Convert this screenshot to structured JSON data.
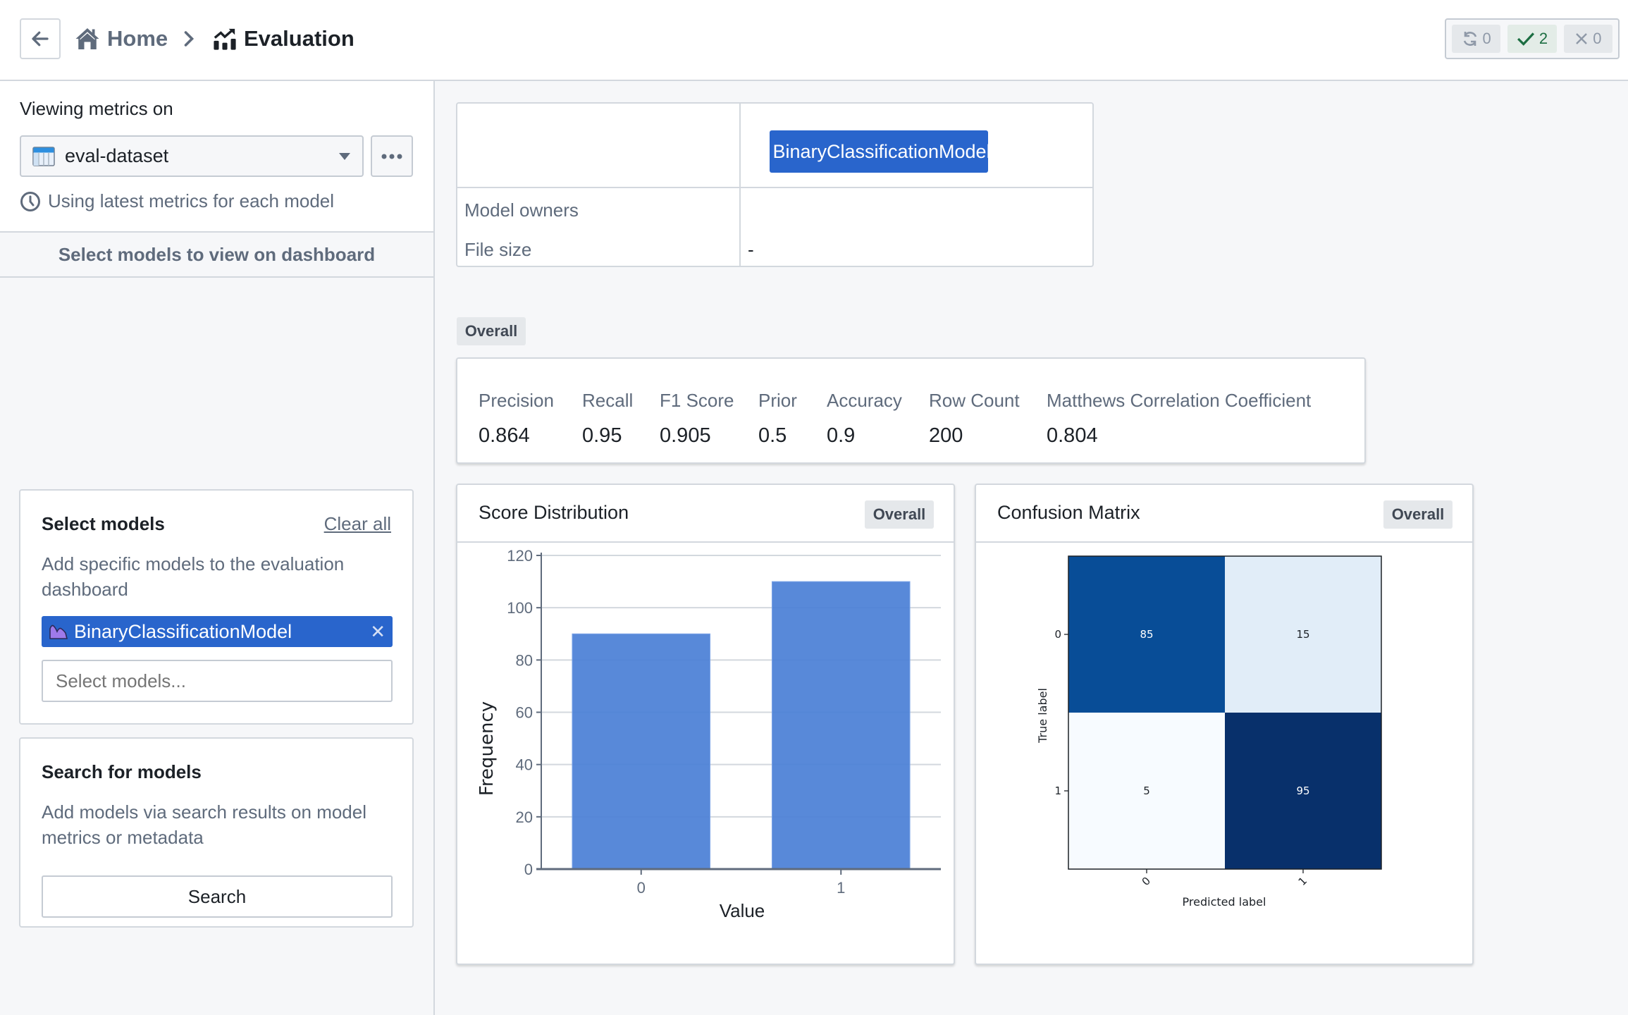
{
  "header": {
    "back_label": "Back",
    "breadcrumb": [
      {
        "label": "Home",
        "icon": "home-icon"
      },
      {
        "label": "Evaluation",
        "icon": "chart-growth-icon"
      }
    ],
    "status": [
      {
        "icon": "refresh-icon",
        "count": "0"
      },
      {
        "icon": "check-icon",
        "count": "2"
      },
      {
        "icon": "cross-icon",
        "count": "0"
      }
    ]
  },
  "sidebar": {
    "viewing_label": "Viewing metrics on",
    "dataset": {
      "icon": "dataset-table-icon",
      "value": "eval-dataset"
    },
    "latest_text": "Using latest metrics for each model",
    "section_title": "Select models to view on dashboard",
    "select_card": {
      "title": "Select models",
      "clear_all": "Clear all",
      "description": "Add specific models to the evaluation dashboard",
      "selected": [
        {
          "name": "BinaryClassificationModel"
        }
      ],
      "input_placeholder": "Select models..."
    },
    "search_card": {
      "title": "Search for models",
      "description": "Add models via search results on model metrics or metadata",
      "button": "Search"
    }
  },
  "main": {
    "model_table": {
      "model": "BinaryClassificationModel",
      "rows": [
        {
          "label": "Model owners",
          "value": ""
        },
        {
          "label": "File size",
          "value": "-"
        }
      ]
    },
    "overall_tag": "Overall",
    "metrics": [
      {
        "label": "Precision",
        "value": "0.864"
      },
      {
        "label": "Recall",
        "value": "0.95"
      },
      {
        "label": "F1 Score",
        "value": "0.905"
      },
      {
        "label": "Prior",
        "value": "0.5"
      },
      {
        "label": "Accuracy",
        "value": "0.9"
      },
      {
        "label": "Row Count",
        "value": "200"
      },
      {
        "label": "Matthews Correlation Coefficient",
        "value": "0.804"
      }
    ],
    "score_card": {
      "title": "Score Distribution",
      "tag": "Overall"
    },
    "cm_card": {
      "title": "Confusion Matrix",
      "tag": "Overall"
    }
  },
  "colors": {
    "accent": "#2965cc",
    "bar": "#4a7fd6",
    "model_icon": "#9f7aea",
    "success": "#1c6e42"
  },
  "chart_data": [
    {
      "type": "bar",
      "title": "Score Distribution",
      "categories": [
        "0",
        "1"
      ],
      "values": [
        90,
        110
      ],
      "xlabel": "Value",
      "ylabel": "Frequency",
      "ylim": [
        0,
        120
      ],
      "yticks": [
        0,
        20,
        40,
        60,
        80,
        100,
        120
      ],
      "grid": true
    },
    {
      "type": "heatmap",
      "title": "Confusion Matrix",
      "x_categories": [
        "0",
        "1"
      ],
      "y_categories": [
        "0",
        "1"
      ],
      "values": [
        [
          85,
          15
        ],
        [
          5,
          95
        ]
      ],
      "xlabel": "Predicted label",
      "ylabel": "True label",
      "colormap": "Blues"
    }
  ]
}
